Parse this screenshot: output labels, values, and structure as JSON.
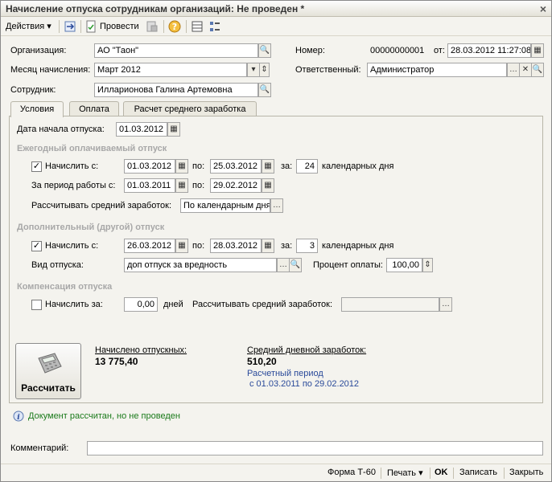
{
  "window": {
    "title": "Начисление отпуска сотрудникам организаций: Не проведен *"
  },
  "toolbar": {
    "actions_label": "Действия",
    "post_label": "Провести"
  },
  "header": {
    "org_label": "Организация:",
    "org_value": "АО \"Таон\"",
    "month_label": "Месяц начисления:",
    "month_value": "Март 2012",
    "employee_label": "Сотрудник:",
    "employee_value": "Илларионова Галина Артемовна",
    "number_label": "Номер:",
    "number_value": "00000000001",
    "date_label": "от:",
    "date_value": "28.03.2012 11:27:08",
    "responsible_label": "Ответственный:",
    "responsible_value": "Администратор"
  },
  "tabs": [
    {
      "label": "Условия"
    },
    {
      "label": "Оплата"
    },
    {
      "label": "Расчет среднего заработка"
    }
  ],
  "conditions": {
    "start_label": "Дата начала отпуска:",
    "start_value": "01.03.2012",
    "annual": {
      "title": "Ежегодный оплачиваемый отпуск",
      "accrue_label": "Начислить с:",
      "from": "01.03.2012",
      "to_label": "по:",
      "to": "25.03.2012",
      "for_label": "за:",
      "days": "24",
      "days_unit": "календарных дня",
      "period_label": "За период работы с:",
      "period_from": "01.03.2011",
      "period_to_label": "по:",
      "period_to": "29.02.2012",
      "avg_label": "Рассчитывать средний заработок:",
      "avg_value": "По календарным дня"
    },
    "additional": {
      "title": "Дополнительный (другой) отпуск",
      "accrue_label": "Начислить с:",
      "from": "26.03.2012",
      "to_label": "по:",
      "to": "28.03.2012",
      "for_label": "за:",
      "days": "3",
      "days_unit": "календарных дня",
      "kind_label": "Вид отпуска:",
      "kind_value": "доп отпуск за вредность",
      "rate_label": "Процент оплаты:",
      "rate_value": "100,00"
    },
    "compensation": {
      "title": "Компенсация отпуска",
      "accrue_label": "Начислить за:",
      "days": "0,00",
      "days_unit": "дней",
      "avg_label": "Рассчитывать средний заработок:",
      "avg_value": ""
    }
  },
  "results": {
    "calc_button": "Рассчитать",
    "accrued_label": "Начислено отпускных:",
    "accrued_value": "13 775,40",
    "avg_daily_label": "Средний дневной заработок:",
    "avg_daily_value": "510,20",
    "period_label": "Расчетный период",
    "period_value": "с 01.03.2011 по 29.02.2012"
  },
  "status": {
    "message": "Документ рассчитан, но не проведен"
  },
  "comment": {
    "label": "Комментарий:",
    "value": ""
  },
  "footer": {
    "form_label": "Форма Т-60",
    "print_label": "Печать",
    "ok_label": "OK",
    "save_label": "Записать",
    "close_label": "Закрыть"
  }
}
